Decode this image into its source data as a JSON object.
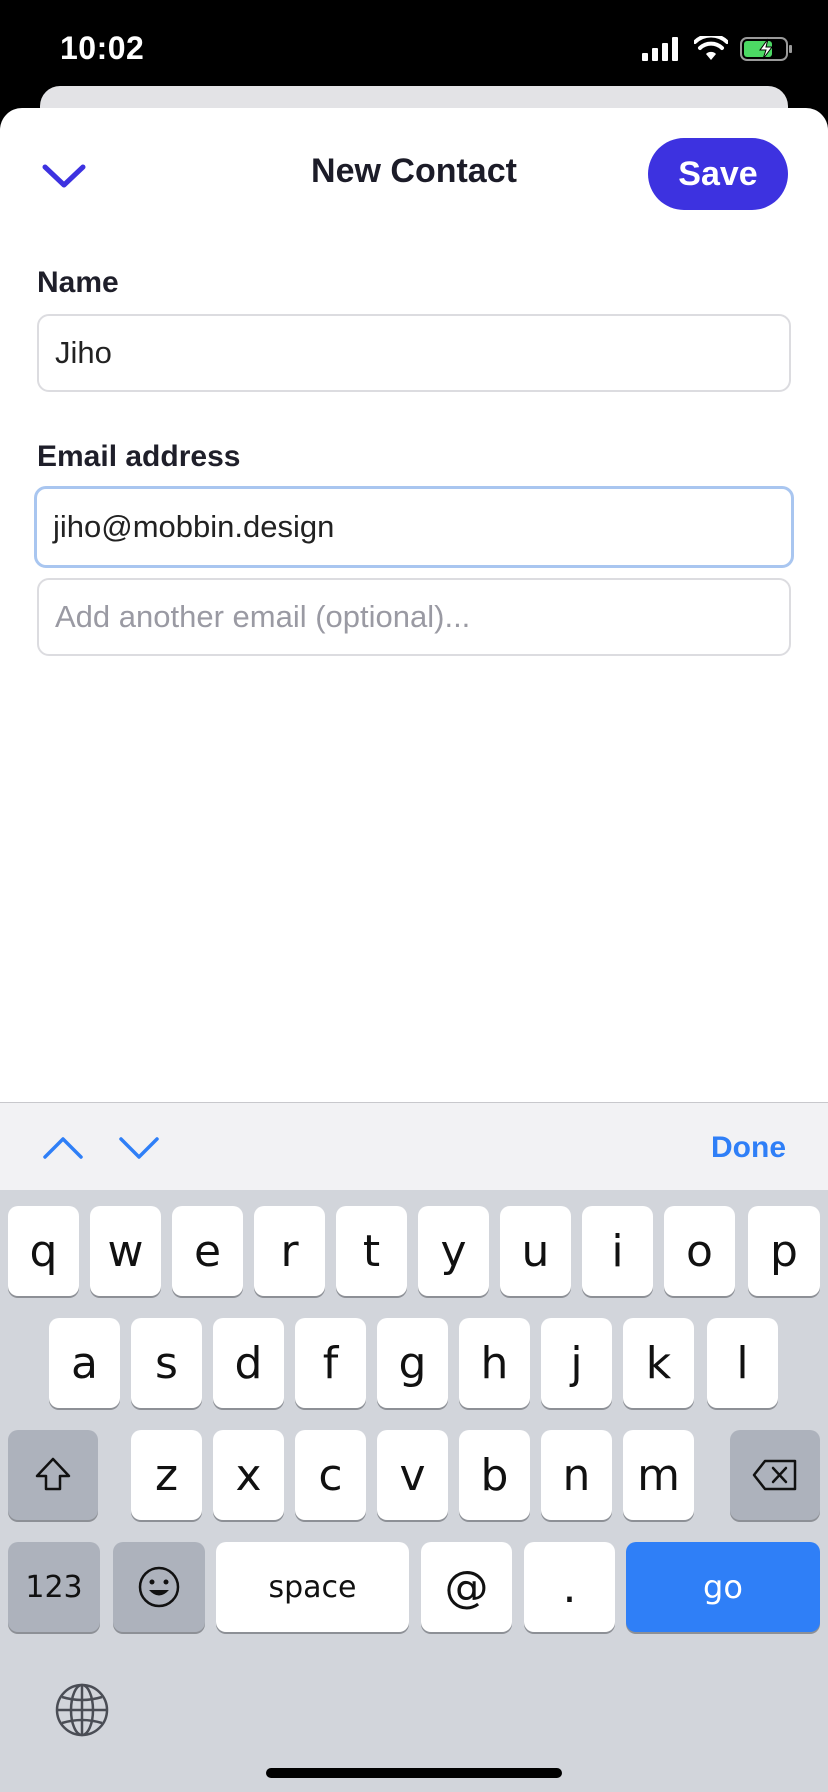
{
  "status_bar": {
    "time": "10:02"
  },
  "header": {
    "title": "New Contact",
    "save_label": "Save",
    "collapse_icon": "chevron-down-icon"
  },
  "form": {
    "name_label": "Name",
    "name_value": "Jiho",
    "email_label": "Email address",
    "email_value": "jiho@mobbin.design",
    "extra_email_placeholder": "Add another email (optional)..."
  },
  "keyboard_toolbar": {
    "done_label": "Done"
  },
  "keyboard": {
    "row1": [
      "q",
      "w",
      "e",
      "r",
      "t",
      "y",
      "u",
      "i",
      "o",
      "p"
    ],
    "row2": [
      "a",
      "s",
      "d",
      "f",
      "g",
      "h",
      "j",
      "k",
      "l"
    ],
    "row3": [
      "z",
      "x",
      "c",
      "v",
      "b",
      "n",
      "m"
    ],
    "numbers_label": "123",
    "space_label": "space",
    "at_label": "@",
    "dot_label": ".",
    "go_label": "go"
  },
  "colors": {
    "accent": "#3d32e0",
    "keyboard_blue": "#2f7ff7",
    "focus_border": "#a9c6f0"
  }
}
